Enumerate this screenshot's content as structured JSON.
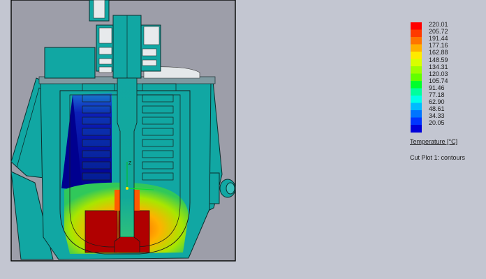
{
  "legend": {
    "title": "Temperature [°C]",
    "values": [
      "220.01",
      "205.72",
      "191.44",
      "177.16",
      "162.88",
      "148.59",
      "134.31",
      "120.03",
      "105.74",
      "91.46",
      "77.18",
      "62.90",
      "48.61",
      "34.33",
      "20.05"
    ],
    "colors": [
      "#ff0000",
      "#ff3a00",
      "#ff7400",
      "#ffaf00",
      "#ffea00",
      "#d8ff00",
      "#9dff00",
      "#62ff00",
      "#00ff2b",
      "#00ff9d",
      "#00ffe9",
      "#00bbff",
      "#0075ff",
      "#0035ff",
      "#0000d9"
    ]
  },
  "caption": "Cut Plot 1: contours",
  "colors": {
    "background": "#c3c6d1",
    "frame": "#9d9ea9",
    "teal": "#11a7a3",
    "hot": "#b00000",
    "cold": "#00009e"
  }
}
